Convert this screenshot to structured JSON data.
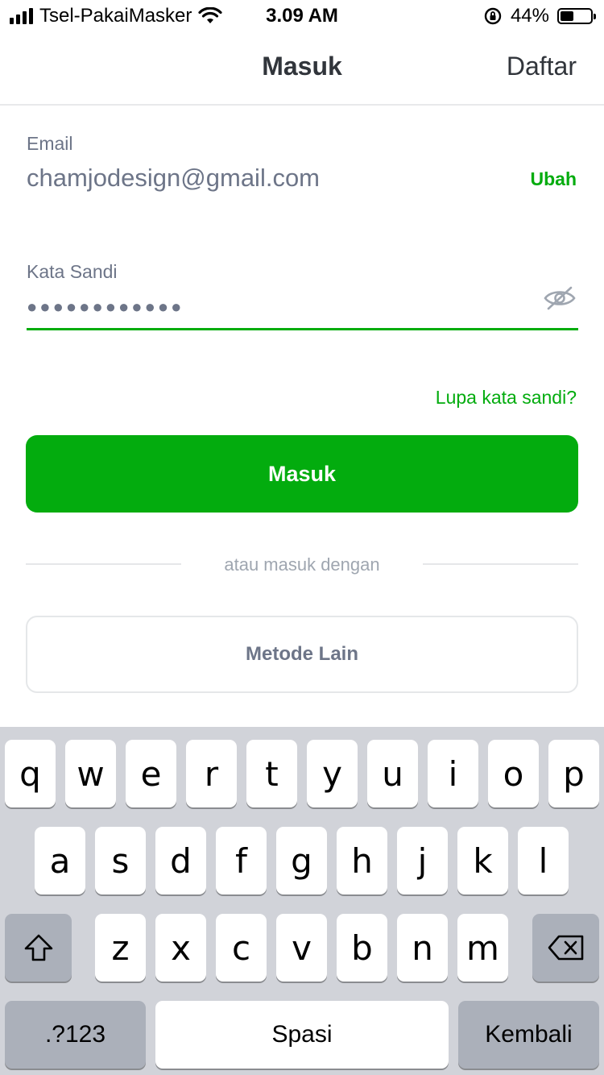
{
  "status_bar": {
    "carrier": "Tsel-PakaiMasker",
    "time": "3.09 AM",
    "battery_percent": "44%",
    "battery_level": 0.44,
    "icons": [
      "signal-icon",
      "wifi-icon",
      "orientation-lock-icon",
      "battery-icon"
    ]
  },
  "nav": {
    "title": "Masuk",
    "right_action": "Daftar"
  },
  "form": {
    "email_label": "Email",
    "email_value": "chamjodesign@gmail.com",
    "change_link": "Ubah",
    "password_label": "Kata Sandi",
    "password_masked": "●●●●●●●●●●●●",
    "password_toggle_icon": "eye-off-icon",
    "forgot_link": "Lupa kata sandi?"
  },
  "actions": {
    "login_button": "Masuk",
    "divider_text": "atau masuk dengan",
    "other_method_button": "Metode Lain"
  },
  "keyboard": {
    "row1": [
      "q",
      "w",
      "e",
      "r",
      "t",
      "y",
      "u",
      "i",
      "o",
      "p"
    ],
    "row2": [
      "a",
      "s",
      "d",
      "f",
      "g",
      "h",
      "j",
      "k",
      "l"
    ],
    "row3": [
      "z",
      "x",
      "c",
      "v",
      "b",
      "n",
      "m"
    ],
    "numbers_key": ".?123",
    "space_key": "Spasi",
    "return_key": "Kembali",
    "shift_icon": "shift-icon",
    "delete_icon": "backspace-icon"
  },
  "colors": {
    "accent": "#03ac0e",
    "text_primary": "#31353b",
    "text_secondary": "#6d7588",
    "keyboard_bg": "#d1d3d9"
  }
}
